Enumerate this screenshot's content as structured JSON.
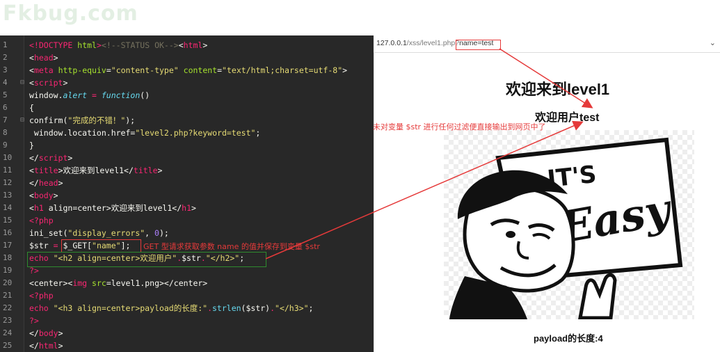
{
  "watermark": "Fkbug.com",
  "editor": {
    "lines": [
      {
        "n": "1"
      },
      {
        "n": "2"
      },
      {
        "n": "3"
      },
      {
        "n": "4"
      },
      {
        "n": "5"
      },
      {
        "n": "6"
      },
      {
        "n": "7"
      },
      {
        "n": "8"
      },
      {
        "n": "9"
      },
      {
        "n": "10"
      },
      {
        "n": "11"
      },
      {
        "n": "12"
      },
      {
        "n": "13"
      },
      {
        "n": "14"
      },
      {
        "n": "15"
      },
      {
        "n": "16"
      },
      {
        "n": "17"
      },
      {
        "n": "18"
      },
      {
        "n": "19"
      },
      {
        "n": "20"
      },
      {
        "n": "21"
      },
      {
        "n": "22"
      },
      {
        "n": "23"
      },
      {
        "n": "24"
      },
      {
        "n": "25"
      }
    ],
    "code": {
      "l1": [
        "<!",
        "DOCTYPE",
        " ",
        "html",
        ">",
        "<!--STATUS OK-->",
        "<",
        "html",
        ">"
      ],
      "l2": [
        "<",
        "head",
        ">"
      ],
      "l3": [
        "<",
        "meta",
        " ",
        "http-equiv",
        "=",
        "\"content-type\"",
        " ",
        "content",
        "=",
        "\"text/html;charset=utf-8\"",
        ">"
      ],
      "l4": [
        "<",
        "script",
        ">"
      ],
      "l5": [
        "window.",
        "alert",
        " = ",
        "function",
        "()"
      ],
      "l6": [
        "{"
      ],
      "l7": [
        "confirm(",
        "\"完成的不错！\"",
        ");"
      ],
      "l8": [
        " window.location.href=",
        "\"level2.php?keyword=test\"",
        ";"
      ],
      "l9": [
        "}"
      ],
      "l10": [
        "</",
        "script",
        ">"
      ],
      "l11": [
        "<",
        "title",
        ">",
        "欢迎来到level1",
        "</",
        "title",
        ">"
      ],
      "l12": [
        "</",
        "head",
        ">"
      ],
      "l13": [
        "<",
        "body",
        ">"
      ],
      "l14": [
        "<",
        "h1",
        " align=center>",
        "欢迎来到level1",
        "</",
        "h1",
        ">"
      ],
      "l15": [
        "<?php"
      ],
      "l16": [
        "ini_set(",
        "\"display_errors\"",
        ", ",
        "0",
        ");"
      ],
      "l17": [
        "$str ",
        "= ",
        "$_GET[",
        "\"name\"",
        "];"
      ],
      "l18": [
        "echo ",
        "\"<h2 align=center>欢迎用户\"",
        ".",
        "$str",
        ".",
        "\"</h2>\"",
        ";"
      ],
      "l19": [
        "?>"
      ],
      "l20": [
        "<center>",
        "<",
        "img",
        " ",
        "src",
        "=level1.png>",
        "</center>"
      ],
      "l21": [
        "<?php"
      ],
      "l22": [
        "echo ",
        "\"<h3 align=center>payload的长度:\"",
        ".",
        "strlen",
        "($str)",
        ".",
        "\"</h3>\"",
        ";"
      ],
      "l23": [
        "?>"
      ],
      "l24": [
        "</",
        "body",
        ">"
      ],
      "l25": [
        "</",
        "html",
        ">"
      ]
    }
  },
  "annotations": {
    "get_note": "GET 型请求获取参数 name 的值并保存到变量 $str",
    "output_note": "未对变量 $str 进行任何过滤便直接输出到网页中了"
  },
  "browser": {
    "url_host": "127.0.0.1",
    "url_path": "/xss/level1.php?",
    "url_query": "name=test",
    "h1": "欢迎来到level1",
    "h2": "欢迎用户test",
    "image_text": [
      "IT'S",
      "Easy"
    ],
    "h3": "payload的长度:4"
  },
  "colors": {
    "editor_bg": "#282828",
    "annotation_red": "#e53a3a",
    "annotation_green": "#2e8b2e"
  }
}
